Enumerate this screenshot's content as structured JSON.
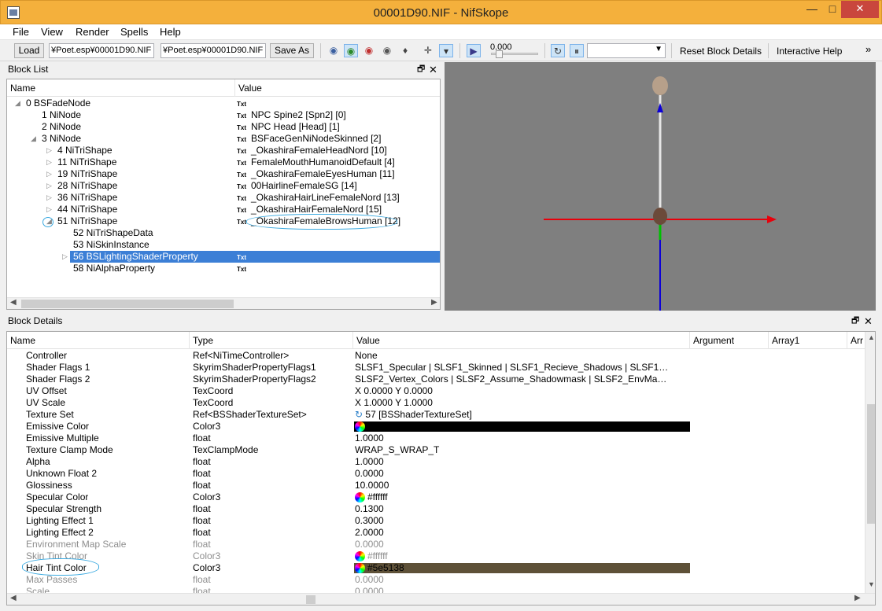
{
  "window": {
    "title": "00001D90.NIF - NifSkope",
    "min": "—",
    "max": "□",
    "close": "✕"
  },
  "menu": [
    "File",
    "View",
    "Render",
    "Spells",
    "Help"
  ],
  "toolbar": {
    "load": "Load",
    "path1": "¥Poet.esp¥00001D90.NIF",
    "path2": "¥Poet.esp¥00001D90.NIF",
    "save_as": "Save As",
    "time": "0.000",
    "reset_block_details": "Reset Block Details",
    "interactive_help": "Interactive Help",
    "more": "»"
  },
  "block_list": {
    "title": "Block List",
    "col_name": "Name",
    "col_value": "Value",
    "txt_tag": "Txt",
    "rows": [
      {
        "indent": 0,
        "expander": "open",
        "name": "0 BSFadeNode",
        "value": "",
        "txt": true
      },
      {
        "indent": 1,
        "expander": "none",
        "name": "1 NiNode",
        "value": "NPC Spine2 [Spn2] [0]",
        "txt": true
      },
      {
        "indent": 1,
        "expander": "none",
        "name": "2 NiNode",
        "value": "NPC Head [Head] [1]",
        "txt": true
      },
      {
        "indent": 1,
        "expander": "open",
        "name": "3 NiNode",
        "value": "BSFaceGenNiNodeSkinned [2]",
        "txt": true
      },
      {
        "indent": 2,
        "expander": "closed",
        "name": "4 NiTriShape",
        "value": "_OkashiraFemaleHeadNord [10]",
        "txt": true
      },
      {
        "indent": 2,
        "expander": "closed",
        "name": "11 NiTriShape",
        "value": "FemaleMouthHumanoidDefault [4]",
        "txt": true
      },
      {
        "indent": 2,
        "expander": "closed",
        "name": "19 NiTriShape",
        "value": "_OkashiraFemaleEyesHuman [11]",
        "txt": true
      },
      {
        "indent": 2,
        "expander": "closed",
        "name": "28 NiTriShape",
        "value": "00HairlineFemaleSG [14]",
        "txt": true
      },
      {
        "indent": 2,
        "expander": "closed",
        "name": "36 NiTriShape",
        "value": "_OkashiraHairLineFemaleNord [13]",
        "txt": true
      },
      {
        "indent": 2,
        "expander": "closed",
        "name": "44 NiTriShape",
        "value": "_OkashiraHairFemaleNord [15]",
        "txt": true
      },
      {
        "indent": 2,
        "expander": "open",
        "name": "51 NiTriShape",
        "value": "_OkashiraFemaleBrowsHuman [12]",
        "txt": true
      },
      {
        "indent": 3,
        "expander": "none",
        "name": "52 NiTriShapeData",
        "value": "",
        "txt": false
      },
      {
        "indent": 3,
        "expander": "none",
        "name": "53 NiSkinInstance",
        "value": "",
        "txt": false
      },
      {
        "indent": 3,
        "expander": "closed",
        "name": "56 BSLightingShaderProperty",
        "value": "",
        "txt": true,
        "selected": true
      },
      {
        "indent": 3,
        "expander": "none",
        "name": "58 NiAlphaProperty",
        "value": "",
        "txt": true
      }
    ]
  },
  "block_details": {
    "title": "Block Details",
    "columns": [
      "Name",
      "Type",
      "Value",
      "Argument",
      "Array1",
      "Arr"
    ],
    "rows": [
      {
        "name": "Controller",
        "type": "Ref<NiTimeController>",
        "value": "None"
      },
      {
        "name": "Shader Flags 1",
        "type": "SkyrimShaderPropertyFlags1",
        "value": "SLSF1_Specular | SLSF1_Skinned | SLSF1_Recieve_Shadows | SLSF1…"
      },
      {
        "name": "Shader Flags 2",
        "type": "SkyrimShaderPropertyFlags2",
        "value": "SLSF2_Vertex_Colors | SLSF2_Assume_Shadowmask | SLSF2_EnvMa…"
      },
      {
        "name": "UV Offset",
        "type": "TexCoord",
        "value": "X 0.0000 Y 0.0000"
      },
      {
        "name": "UV Scale",
        "type": "TexCoord",
        "value": "X 1.0000 Y 1.0000"
      },
      {
        "name": "Texture Set",
        "type": "Ref<BSShaderTextureSet>",
        "value": "57 [BSShaderTextureSet]",
        "link": true
      },
      {
        "name": "Emissive Color",
        "type": "Color3",
        "value": "",
        "swatch": "#000000"
      },
      {
        "name": "Emissive Multiple",
        "type": "float",
        "value": "1.0000"
      },
      {
        "name": "Texture Clamp Mode",
        "type": "TexClampMode",
        "value": "WRAP_S_WRAP_T"
      },
      {
        "name": "Alpha",
        "type": "float",
        "value": "1.0000"
      },
      {
        "name": "Unknown Float 2",
        "type": "float",
        "value": "0.0000"
      },
      {
        "name": "Glossiness",
        "type": "float",
        "value": "10.0000"
      },
      {
        "name": "Specular Color",
        "type": "Color3",
        "value": "#ffffff",
        "wheel": true
      },
      {
        "name": "Specular Strength",
        "type": "float",
        "value": "0.1300"
      },
      {
        "name": "Lighting Effect 1",
        "type": "float",
        "value": "0.3000"
      },
      {
        "name": "Lighting Effect 2",
        "type": "float",
        "value": "2.0000"
      },
      {
        "name": "Environment Map Scale",
        "type": "float",
        "value": "0.0000",
        "dim": true
      },
      {
        "name": "Skin Tint Color",
        "type": "Color3",
        "value": "#ffffff",
        "wheel": true,
        "dim": true
      },
      {
        "name": "Hair Tint Color",
        "type": "Color3",
        "value": "#5e5138",
        "swatch": "#5e5138"
      },
      {
        "name": "Max Passes",
        "type": "float",
        "value": "0.0000",
        "dim": true
      },
      {
        "name": "Scale",
        "type": "float",
        "value": "0.0000",
        "dim": true
      }
    ]
  },
  "colors": {
    "selection": "#3c7fd6",
    "viewport_bg": "#7f7f7f",
    "axis_x": "#e8000b",
    "axis_y": "#0d00d6",
    "axis_z": "#00c000",
    "titlebar": "#f4b03c",
    "annotation": "#3aa9e0"
  }
}
